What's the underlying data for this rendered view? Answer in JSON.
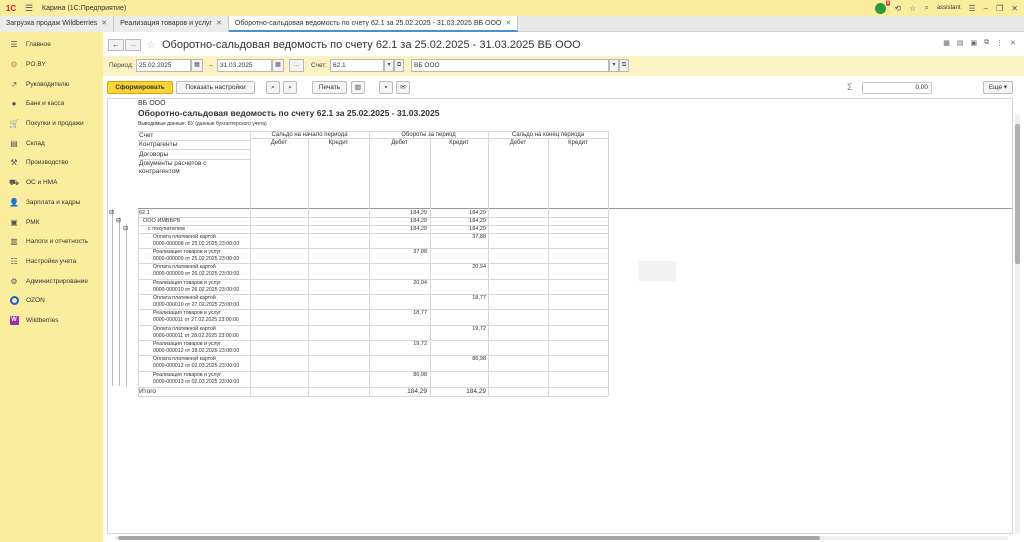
{
  "app": {
    "title": "Карина  (1С:Предприятие)",
    "user": "assistant",
    "notification_count": "9"
  },
  "tabs": [
    {
      "label": "Загрузка продаж Wildberries"
    },
    {
      "label": "Реализация товаров и услуг"
    },
    {
      "label": "Оборотно-сальдовая ведомость по счету 62.1 за 25.02.2025 - 31.03.2025 ВБ ООО"
    }
  ],
  "sidebar": {
    "items": [
      {
        "label": "Главное",
        "icon": "menu-icon"
      },
      {
        "label": "PO.BY",
        "icon": "gear-icon"
      },
      {
        "label": "Руководителю",
        "icon": "trend-icon"
      },
      {
        "label": "Банк и касса",
        "icon": "bank-icon"
      },
      {
        "label": "Покупки и продажи",
        "icon": "cart-icon"
      },
      {
        "label": "Склад",
        "icon": "warehouse-icon"
      },
      {
        "label": "Производство",
        "icon": "factory-icon"
      },
      {
        "label": "ОС и НМА",
        "icon": "truck-icon"
      },
      {
        "label": "Зарплата и кадры",
        "icon": "person-icon"
      },
      {
        "label": "РМК",
        "icon": "register-icon"
      },
      {
        "label": "Налоги и отчетность",
        "icon": "report-icon"
      },
      {
        "label": "Настройки учета",
        "icon": "settings-list-icon"
      },
      {
        "label": "Администрирование",
        "icon": "admin-gear-icon"
      },
      {
        "label": "OZON",
        "icon": "ozon-icon"
      },
      {
        "label": "Wildberries",
        "icon": "wildberries-icon"
      }
    ]
  },
  "header": {
    "title": "Оборотно-сальдовая ведомость по счету 62.1 за 25.02.2025 - 31.03.2025 ВБ ООО"
  },
  "params": {
    "period_label": "Период:",
    "date_from": "25.02.2025",
    "date_to": "31.03.2025",
    "ellipsis": "...",
    "account_label": "Счет:",
    "account": "62.1",
    "organization": "ВБ ООО"
  },
  "toolbar": {
    "generate": "Сформировать",
    "settings": "Показать настройки",
    "print": "Печать",
    "sum_value": "0,00",
    "more": "Еще"
  },
  "report": {
    "org": "ВБ ООО",
    "title": "Оборотно-сальдовая ведомость по счету 62.1 за 25.02.2025 - 31.03.2025",
    "subtitle": "Выводимые данные:  БУ (данные бухгалтерского учета)",
    "col_headers": {
      "account": "Счет",
      "counterparties": "Контрагенты",
      "contracts": "Договоры",
      "settlement_docs": "Документы расчетов с контрагентом",
      "opening_balance": "Сальдо на начало периода",
      "turnover": "Обороты за период",
      "closing_balance": "Сальдо на конец периода",
      "debit": "Дебет",
      "credit": "Кредит"
    },
    "summary_rows": [
      {
        "label": "62.1",
        "debit": "184,29",
        "credit": "184,29"
      },
      {
        "label": "ООО ИМВБРБ",
        "debit": "184,29",
        "credit": "184,29"
      },
      {
        "label": "с покупателем",
        "debit": "184,29",
        "credit": "184,29"
      }
    ],
    "docs": [
      {
        "line1": "Оплата платежной картой",
        "line2": "0000-000008 от 25.02.2025 23:00:00",
        "debit": "",
        "credit": "37,88"
      },
      {
        "line1": "Реализация товаров и услуг",
        "line2": "0000-000009 от 25.02.2025 23:00:00",
        "debit": "37,88",
        "credit": ""
      },
      {
        "line1": "Оплата платежной картой",
        "line2": "0000-000009 от 26.02.2025 23:00:00",
        "debit": "",
        "credit": "20,94"
      },
      {
        "line1": "Реализация товаров и услуг",
        "line2": "0000-000010 от 26.02.2025 23:00:00",
        "debit": "20,94",
        "credit": ""
      },
      {
        "line1": "Оплата платежной картой",
        "line2": "0000-000010 от 27.02.2025 23:00:00",
        "debit": "",
        "credit": "18,77"
      },
      {
        "line1": "Реализация товаров и услуг",
        "line2": "0000-000011 от 27.02.2025 23:00:00",
        "debit": "18,77",
        "credit": ""
      },
      {
        "line1": "Оплата платежной картой",
        "line2": "0000-000011 от 28.02.2025 23:00:00",
        "debit": "",
        "credit": "19,72"
      },
      {
        "line1": "Реализация товаров и услуг",
        "line2": "0000-000012 от 28.02.2025 23:00:00",
        "debit": "19,72",
        "credit": ""
      },
      {
        "line1": "Оплата платежной картой",
        "line2": "0000-000012 от 02.03.2025 23:00:00",
        "debit": "",
        "credit": "86,98"
      },
      {
        "line1": "Реализация товаров и услуг",
        "line2": "0000-000013 от 02.03.2025 23:00:00",
        "debit": "86,98",
        "credit": ""
      }
    ],
    "total": {
      "label": "Итого",
      "debit": "184,29",
      "credit": "184,29"
    }
  }
}
